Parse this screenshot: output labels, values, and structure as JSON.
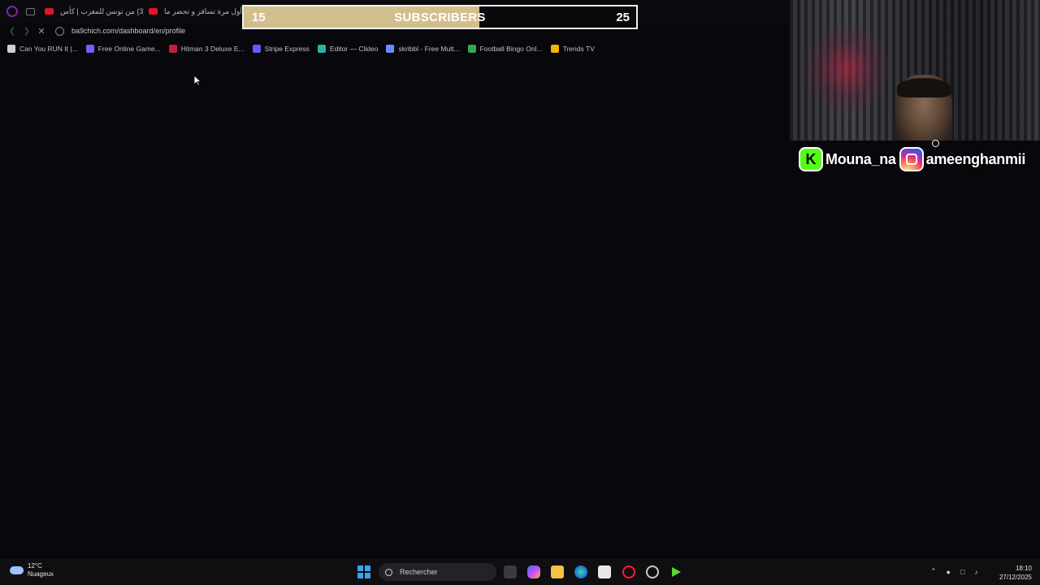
{
  "browser": {
    "tabs": [
      {
        "label": "(3) من تونس للمغرب | كأس"
      },
      {
        "label": "(3) أول مرة تسافر و تحضر ما"
      }
    ],
    "address": {
      "url": "ba9chich.com/dashboard/en/profile"
    },
    "bookmarks": [
      {
        "label": "Can You RUN It |...",
        "color": "#cfcfcf"
      },
      {
        "label": "Free Online Game...",
        "color": "#7b5cff"
      },
      {
        "label": "Hitman 3 Deluxe E...",
        "color": "#c0203a"
      },
      {
        "label": "Stripe Express",
        "color": "#635bff"
      },
      {
        "label": "Editor — Clideo",
        "color": "#2bb3a7"
      },
      {
        "label": "skribbl - Free Mult...",
        "color": "#6b8cff"
      },
      {
        "label": "Football Bingo Onl...",
        "color": "#2fa84f"
      },
      {
        "label": "Trends TV",
        "color": "#f4b400"
      }
    ]
  },
  "overlay": {
    "subscribers": {
      "current": "15",
      "label": "SUBSCRIBERS",
      "goal": "25",
      "progress": 0.6,
      "bar_color": "#d3bf8d"
    },
    "social": {
      "kick_letter": "K",
      "kick_name": "Mouna_na",
      "instagram_name": "ameenghanmii",
      "kick_color": "#53fc18"
    }
  },
  "taskbar": {
    "weather": {
      "temp": "12°C",
      "condition": "Nuageux"
    },
    "search_placeholder": "Rechercher",
    "clock": {
      "time": "18:10",
      "date": "27/12/2025"
    }
  }
}
